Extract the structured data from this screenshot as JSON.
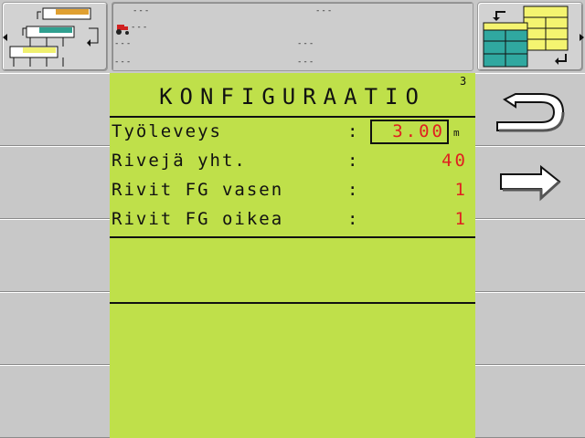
{
  "screen": {
    "title": "KONFIGURAATIO",
    "page_number": "3"
  },
  "status_bar": {
    "lines": [
      "---",
      "---",
      "---",
      "---",
      "---",
      "---",
      "---"
    ]
  },
  "fields": [
    {
      "label": "Työleveys",
      "colon": ":",
      "value": "3.00",
      "unit": "m",
      "editable": true
    },
    {
      "label": "Rivejä yht.",
      "colon": ":",
      "value": "40",
      "unit": "",
      "editable": false
    },
    {
      "label": "Rivit FG vasen",
      "colon": ":",
      "value": "1",
      "unit": "",
      "editable": false
    },
    {
      "label": "Rivit FG oikea",
      "colon": ":",
      "value": "1",
      "unit": "",
      "editable": false
    }
  ],
  "icons": {
    "top_left": "section-control-icon",
    "top_right": "layout-switch-icon",
    "tractor": "tractor-icon",
    "back": "return-arrow-icon",
    "next": "forward-arrow-icon"
  },
  "colors": {
    "panel": "#bfe04a",
    "value": "#e02020",
    "softkey": "#c8c8c8"
  }
}
